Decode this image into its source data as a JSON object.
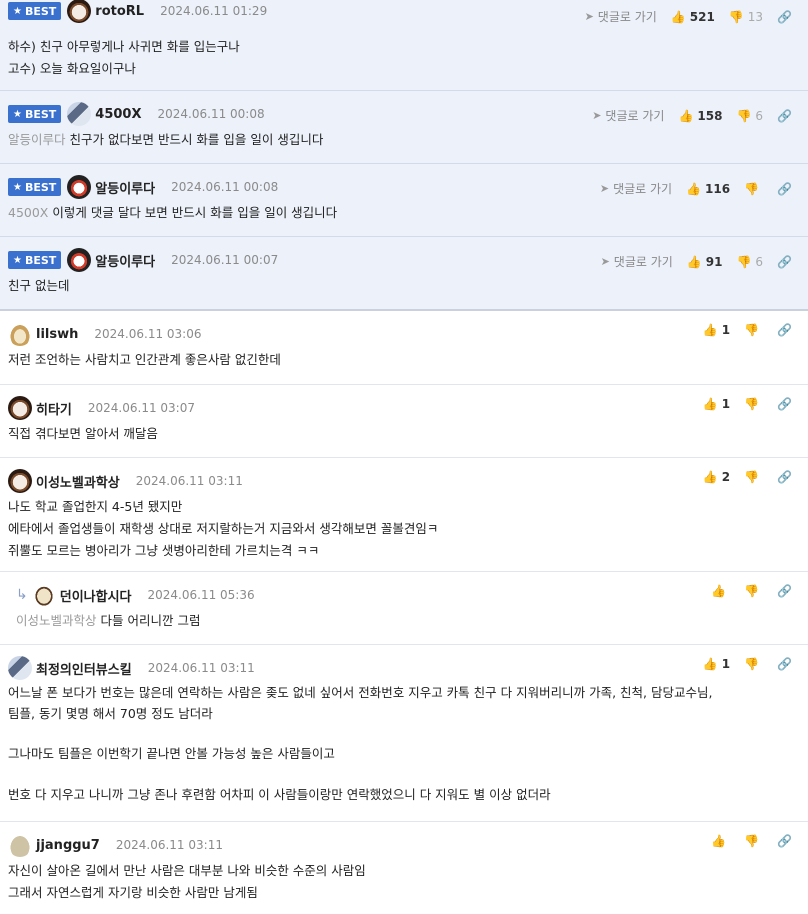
{
  "comments": [
    {
      "best": true,
      "badge": "BEST",
      "nick": "rotoRL",
      "date": "2024.06.11 01:29",
      "reply_label": "댓글로 가기",
      "up": "521",
      "down": "13",
      "lines": [
        "하수) 친구 아무렇게나 사귀면 화를 입는구나",
        "고수) 오늘 화요일이구나"
      ]
    },
    {
      "best": true,
      "badge": "BEST",
      "nick": "4500X",
      "date": "2024.06.11 00:08",
      "reply_label": "댓글로 가기",
      "up": "158",
      "down": "6",
      "mention": "알등이루다",
      "lines": [
        "친구가 없다보면 반드시 화를 입을 일이 생깁니다"
      ]
    },
    {
      "best": true,
      "badge": "BEST",
      "nick": "알등이루다",
      "date": "2024.06.11 00:08",
      "reply_label": "댓글로 가기",
      "up": "116",
      "down": "",
      "mention": "4500X",
      "lines": [
        "이렇게 댓글 달다 보면 반드시 화를 입을 일이 생깁니다"
      ]
    },
    {
      "best": true,
      "badge": "BEST",
      "nick": "알등이루다",
      "date": "2024.06.11 00:07",
      "reply_label": "댓글로 가기",
      "up": "91",
      "down": "6",
      "lines": [
        "친구 없는데"
      ]
    },
    {
      "nick": "lilswh",
      "date": "2024.06.11 03:06",
      "up": "1",
      "lines": [
        "저런 조언하는 사람치고 인간관계 좋은사람 없긴한데"
      ]
    },
    {
      "nick": "히타기",
      "date": "2024.06.11 03:07",
      "up": "1",
      "lines": [
        "직접 겪다보면 알아서 깨달음"
      ]
    },
    {
      "nick": "이성노벨과학상",
      "date": "2024.06.11 03:11",
      "up": "2",
      "lines": [
        "나도 학교 졸업한지 4-5년 됐지만",
        "에타에서 졸업생들이 재학생 상대로 저지랄하는거 지금와서 생각해보면 꼴볼견임ㅋ",
        "쥐뿔도 모르는 병아리가 그냥 샛병아리한테 가르치는격 ㅋㅋ"
      ]
    },
    {
      "nick": "던이나합시다",
      "date": "2024.06.11 05:36",
      "up": "",
      "mention": "이성노벨과학상",
      "lines": [
        "다들 어리니깐 그럼"
      ]
    },
    {
      "nick": "최정의인터뷰스킬",
      "date": "2024.06.11 03:11",
      "up": "1",
      "lines": [
        "어느날 폰 보다가 번호는 많은데 연락하는 사람은 좆도 없네 싶어서 전화번호 지우고 카톡 친구 다 지워버리니까 가족, 친척, 담당교수님,",
        "팀플, 동기 몇명 해서 70명 정도 남더라",
        "",
        "그나마도 팀플은 이번학기 끝나면 안볼 가능성 높은 사람들이고",
        "",
        "번호 다 지우고 나니까 그냥 존나 후련함 어차피 이 사람들이랑만 연락했었으니 다 지워도 별 이상 없더라"
      ]
    },
    {
      "nick": "jjanggu7",
      "date": "2024.06.11 03:11",
      "up": "",
      "lines": [
        "자신이 살아온 길에서 만난 사람은 대부분 나와 비슷한 수준의 사람임",
        "그래서 자연스럽게 자기랑 비슷한 사람만 남게됨"
      ]
    }
  ],
  "icons": {
    "star": "star-icon",
    "reply": "send-icon",
    "up": "thumbs-up-icon",
    "down": "thumbs-down-icon",
    "link": "link-icon",
    "reply_arrow": "reply-arrow-icon"
  },
  "colors": {
    "best_bg": "#ecf1fa",
    "badge": "#3b71ce"
  }
}
